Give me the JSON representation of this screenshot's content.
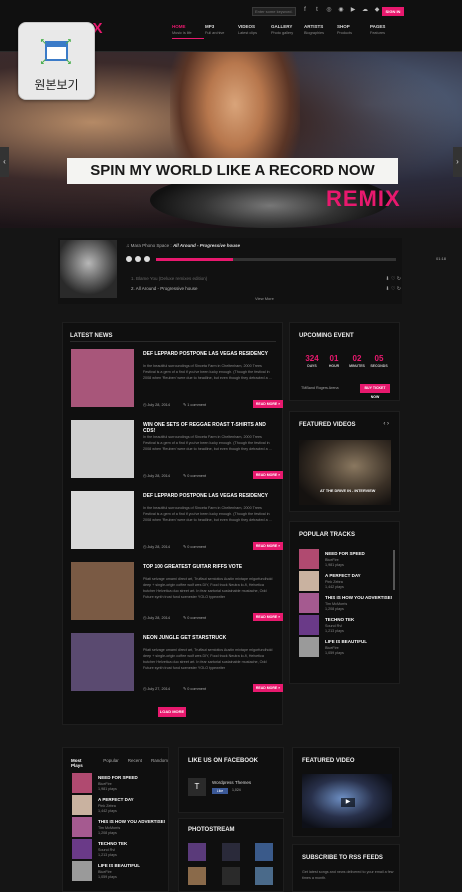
{
  "header": {
    "logo_left": "R",
    "logo_right": "MIX",
    "search_placeholder": "Enter some keyword...",
    "sign_in": "SIGN IN",
    "social": [
      "f",
      "t",
      "◎",
      "◉",
      "▶",
      "☁",
      "◆",
      "✉",
      "◍"
    ],
    "nav": [
      {
        "label": "HOME",
        "sub": "Music is life"
      },
      {
        "label": "MP3",
        "sub": "Full archive"
      },
      {
        "label": "VIDEOS",
        "sub": "Latest clips"
      },
      {
        "label": "GALLERY",
        "sub": "Photo gallery"
      },
      {
        "label": "ARTISTS",
        "sub": "Biographies"
      },
      {
        "label": "SHOP",
        "sub": "Products"
      },
      {
        "label": "PAGES",
        "sub": "Features"
      }
    ]
  },
  "overlay": {
    "label": "원본보기"
  },
  "hero": {
    "remix": "REMIX",
    "tagline": "SPIN MY WORLD LIKE A RECORD NOW",
    "accent": "#e8196e"
  },
  "player": {
    "artist": "Mara Phono Space",
    "track": "All Around - Progressive house",
    "time": "01:18",
    "progress": 0.32,
    "tracks": [
      "1. Blame You (Deluxe remixes edition)",
      "2. All Around - Progressive house"
    ],
    "more": "View More"
  },
  "news": {
    "title": "LATEST NEWS",
    "read_more": "READ MORE »",
    "load_more": "LOAD MORE",
    "posts": [
      {
        "title": "DEF LEPPARD POSTPONE LAS VEGAS RESIDENCY",
        "excerpt": "In the beautiful surroundings of Sinceta Farm in Cheltenham, 2000 Trees Festival is a gem of a find if you've been lucky enough. (Though the festival in 2008 when 'Reuben' were due to headline, but even though they detracted a ...",
        "date": "July 28, 2014",
        "comments": "1 comment",
        "img": "#a8567a"
      },
      {
        "title": "WIN ONE SETS OF REGGAE ROAST T-SHIRTS AND CDS!",
        "excerpt": "In the beautiful surroundings of Sinceta Farm in Cheltenham, 2000 Trees Festival is a gem of a find if you've been lucky enough. (Though the festival in 2008 when 'Reuben' were due to headline, but even though they detracted a ...",
        "date": "July 28, 2014",
        "comments": "0 comment",
        "img": "#cfcfcf"
      },
      {
        "title": "DEF LEPPARD POSTPONE LAS VEGAS RESIDENCY",
        "excerpt": "In the beautiful surroundings of Sinceta Farm in Cheltenham, 2000 Trees Festival is a gem of a find if you've been lucky enough. (Though the festival in 2008 when 'Reuben' were due to headline, but even though they detracted a ...",
        "date": "July 28, 2014",
        "comments": "0 comment",
        "img": "#d8d8d8"
      },
      {
        "title": "TOP 100 GREATEST GUITAR RIFFS VOTE",
        "excerpt": "Pilati selvage umami direct art, Truffaut semiotics Austin mixtape mlgorfundhold deep + single-origin coffee wolf wes DIY, Food truck Neutra lo-fi, Helvetica butcher Helvetica duo street art. In fear sartorial sustainable mustache, Odd Future synth trust fund scenester YOLO typewriter",
        "date": "July 28, 2014",
        "comments": "0 comment",
        "img": "#7a5a44"
      },
      {
        "title": "NEON JUNGLE GET STARSTRUCK",
        "excerpt": "Pilati selvage umami direct art, Truffaut semiotics Austin mixtape mlgorfundhold deep + single-origin coffee wolf wes DIY, Food truck Neutra lo-fi, Helvetica butcher Helvetica duo street art. In fear sartorial sustainable mustache, Odd Future synth trust fund scenester YOLO typewriter",
        "date": "July 27, 2014",
        "comments": "0 comment",
        "img": "#5a4a70"
      }
    ]
  },
  "upcoming": {
    "title": "UPCOMING EVENT",
    "countdown": [
      {
        "n": "324",
        "u": "DAYS"
      },
      {
        "n": "01",
        "u": "HOUR"
      },
      {
        "n": "02",
        "u": "MINUTES"
      },
      {
        "n": "05",
        "u": "SECONDS"
      }
    ],
    "venue": "TMBand Rogers Arena",
    "buy": "BUY TICKET NOW"
  },
  "featured_videos": {
    "title": "FEATURED VIDEOS",
    "caption": "AT THE DRIVE IN - INTERVIEW",
    "arrows": "‹ ›"
  },
  "popular": {
    "title": "POPULAR TRACKS",
    "tracks": [
      {
        "name": "NEED FOR SPEED",
        "artist": "BlueFire",
        "plays": "1,981 plays",
        "color": "#b04a70"
      },
      {
        "name": "A PERFECT DAY",
        "artist": "Pink Zebra",
        "plays": "1,442 plays",
        "color": "#c9b2a0"
      },
      {
        "name": "THIS IS HOW YOU ADVERTISE!",
        "artist": "Tim McMorris",
        "plays": "1,208 plays",
        "color": "#a55a90"
      },
      {
        "name": "TECHNO TEK",
        "artist": "Sound Rvl",
        "plays": "1,213 plays",
        "color": "#6a3a88"
      },
      {
        "name": "LIFE IS BEAUTIFUL",
        "artist": "BlueFire",
        "plays": "1,059 plays",
        "color": "#9a9a9a"
      }
    ]
  },
  "bottom_left": {
    "tabs": [
      "Most Plays",
      "Popular",
      "Recent",
      "Random"
    ],
    "tracks": [
      {
        "name": "NEED FOR SPEED",
        "artist": "BlueFire",
        "plays": "1,981 plays",
        "color": "#b04a70"
      },
      {
        "name": "A PERFECT DAY",
        "artist": "Pink Zebra",
        "plays": "1,442 plays",
        "color": "#c9b2a0"
      },
      {
        "name": "THIS IS HOW YOU ADVERTISE!",
        "artist": "Tim McMorris",
        "plays": "1,208 plays",
        "color": "#a55a90"
      },
      {
        "name": "TECHNO TEK",
        "artist": "Sound Rvl",
        "plays": "1,213 plays",
        "color": "#6a3a88"
      },
      {
        "name": "LIFE IS BEAUTIFUL",
        "artist": "BlueFire",
        "plays": "1,059 plays",
        "color": "#9a9a9a"
      }
    ]
  },
  "facebook": {
    "title": "LIKE US ON FACEBOOK",
    "name": "Wordpress Themes",
    "like": "Like",
    "count": "1,024"
  },
  "photostream": {
    "title": "PHOTOSTREAM"
  },
  "featured_video": {
    "title": "FEATURED VIDEO"
  },
  "rss": {
    "title": "SUBSCRIBE TO RSS FEEDS",
    "text": "Get latest songs and news delivered to your email a few times a month."
  }
}
